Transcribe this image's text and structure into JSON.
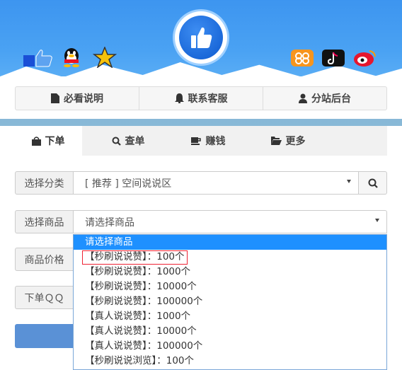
{
  "top_nav": [
    {
      "icon": "document-icon",
      "label": "必看说明"
    },
    {
      "icon": "bell-icon",
      "label": "联系客服"
    },
    {
      "icon": "user-icon",
      "label": "分站后台"
    }
  ],
  "tabs": [
    {
      "icon": "shopping-bag-icon",
      "label": "下单",
      "active": true
    },
    {
      "icon": "search-icon",
      "label": "查单",
      "active": false
    },
    {
      "icon": "coffee-cup-icon",
      "label": "赚钱",
      "active": false
    },
    {
      "icon": "folder-open-icon",
      "label": "更多",
      "active": false
    }
  ],
  "form": {
    "category_label": "选择分类",
    "category_value": "[ 推荐 ] 空间说说区",
    "product_label": "选择商品",
    "product_value": "请选择商品",
    "price_label": "商品价格",
    "qq_label": "下单ＱＱ"
  },
  "dropdown": {
    "options": [
      "请选择商品",
      "【秒刷说说赞】：100个",
      "【秒刷说说赞】：1000个",
      "【秒刷说说赞】：10000个",
      "【秒刷说说赞】：100000个",
      "【真人说说赞】：1000个",
      "【真人说说赞】：10000个",
      "【真人说说赞】：100000个",
      "【秒刷说说浏览】：100个"
    ],
    "selected_index": 0,
    "highlighted_index": 1
  },
  "colors": {
    "accent": "#1e90ff",
    "highlight_border": "#e23",
    "hero": "#4aa2f3"
  }
}
